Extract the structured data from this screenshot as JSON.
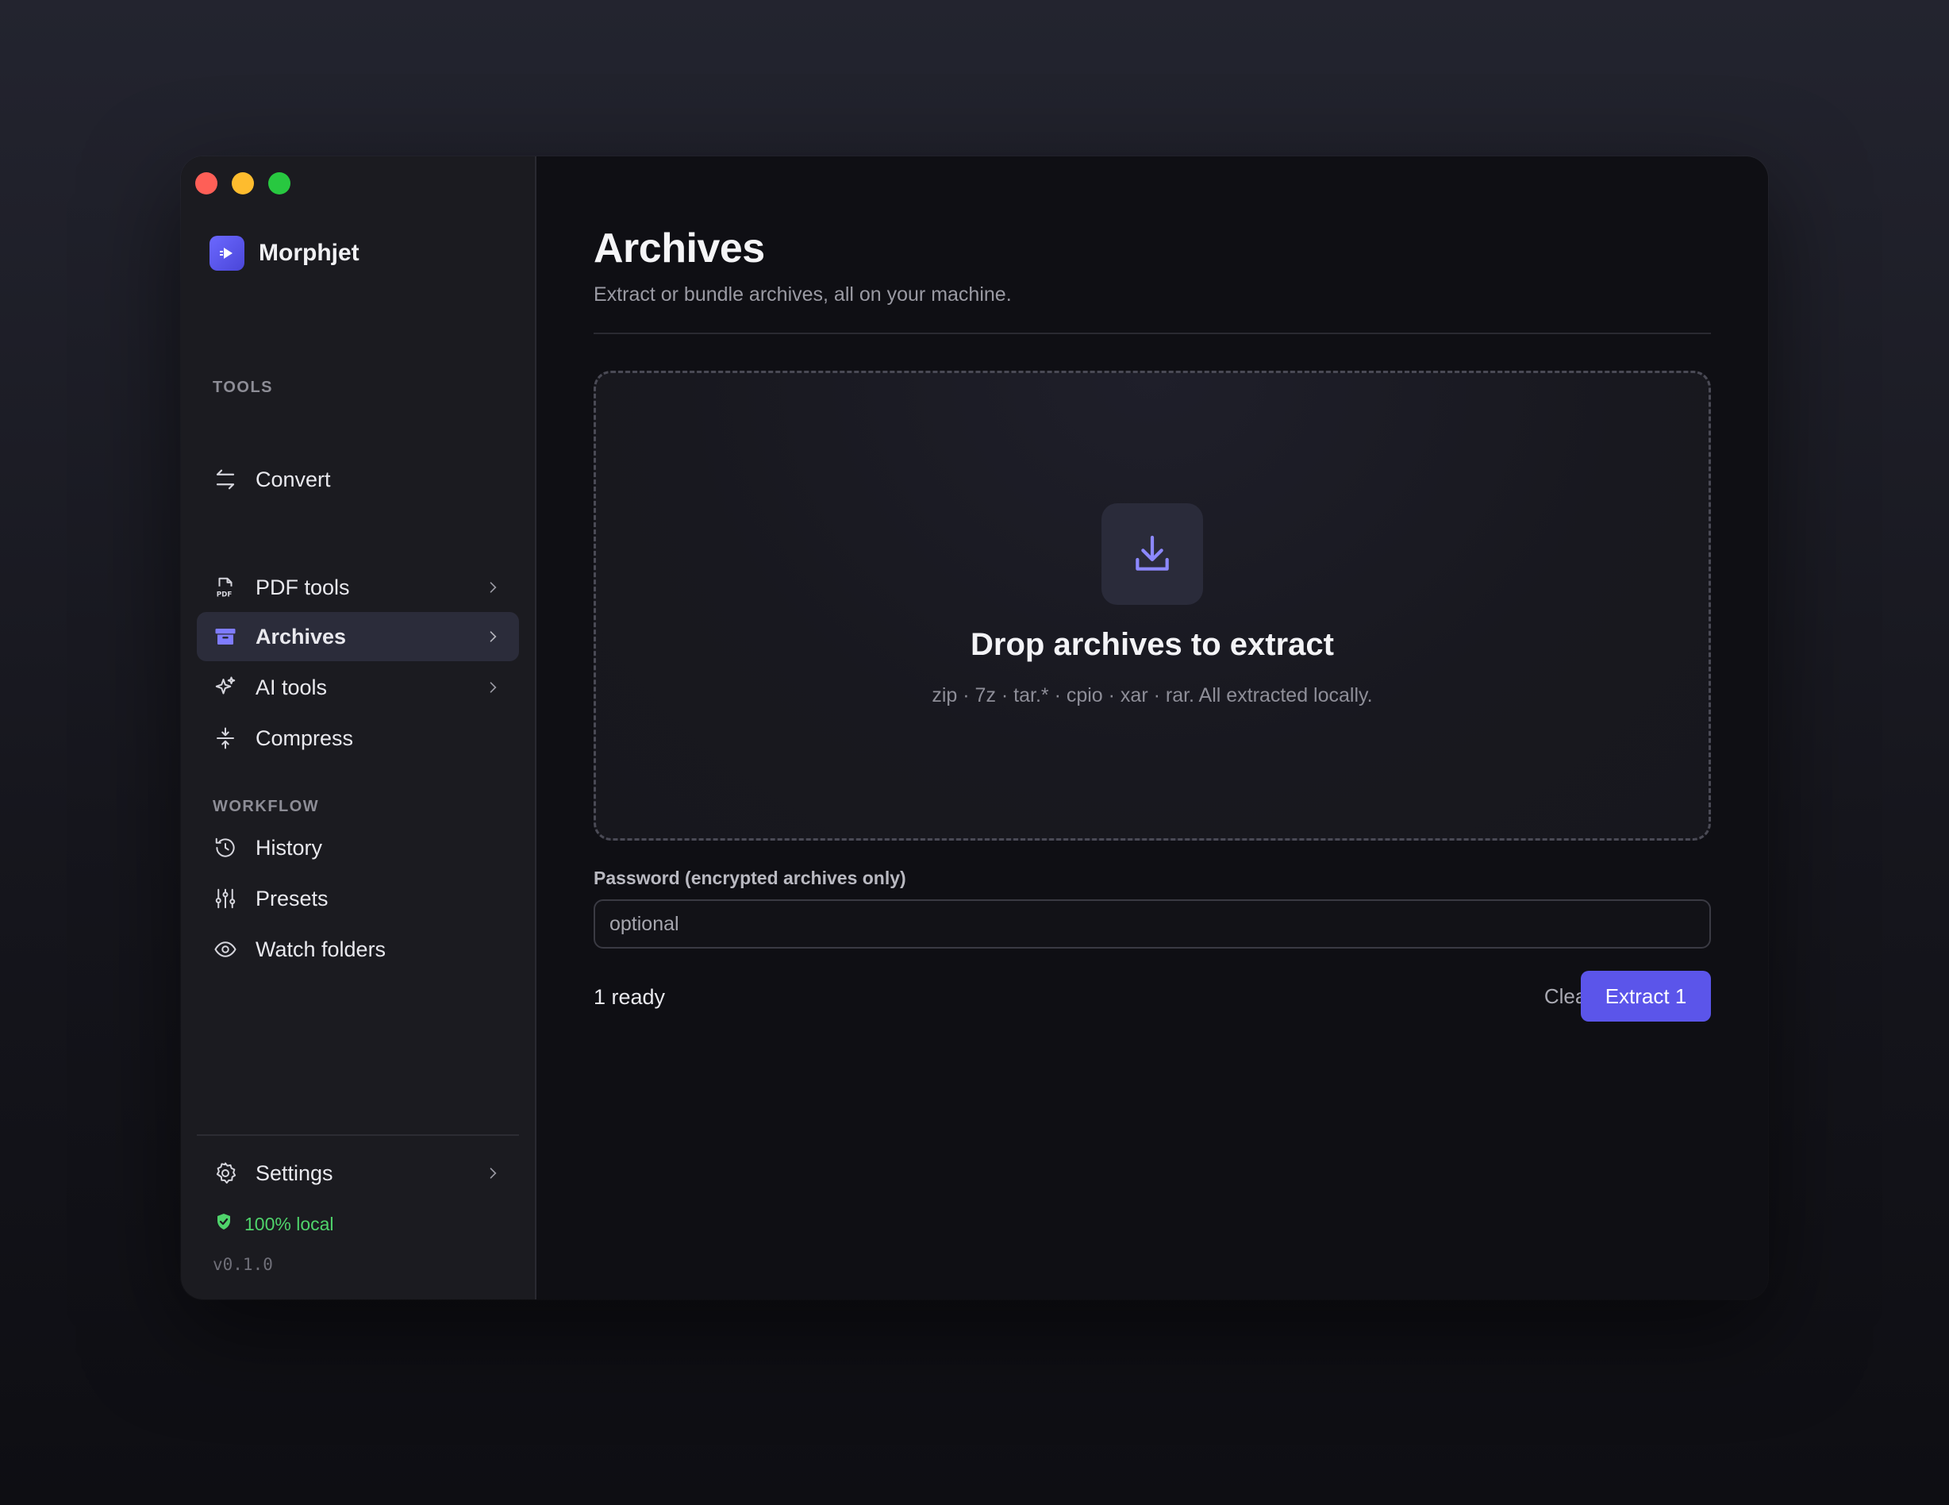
{
  "app": {
    "name": "Morphjet"
  },
  "sidebar": {
    "convert": {
      "label": "Convert",
      "icon": "arrows-exchange-icon"
    },
    "tools_header": "TOOLS",
    "tools": [
      {
        "label": "PDF tools",
        "icon": "pdf-file-icon",
        "has_submenu": true
      },
      {
        "label": "Archives",
        "icon": "archive-box-icon",
        "has_submenu": true,
        "active": true
      },
      {
        "label": "AI tools",
        "icon": "sparkles-icon",
        "has_submenu": true
      },
      {
        "label": "Compress",
        "icon": "compress-icon",
        "has_submenu": false
      }
    ],
    "workflow_header": "WORKFLOW",
    "workflow": [
      {
        "label": "History",
        "icon": "history-icon"
      },
      {
        "label": "Presets",
        "icon": "sliders-icon"
      },
      {
        "label": "Watch folders",
        "icon": "eye-icon"
      }
    ],
    "settings": {
      "label": "Settings",
      "icon": "gear-icon"
    },
    "local_badge": "100% local",
    "version": "v0.1.0"
  },
  "main": {
    "title": "Archives",
    "subtitle": "Extract or bundle archives, all on your machine.",
    "dropzone": {
      "title": "Drop archives to extract",
      "subtitle": "zip · 7z · tar.* · cpio · xar · rar. All extracted locally."
    },
    "password": {
      "label": "Password (encrypted archives only)",
      "placeholder": "optional",
      "value": ""
    },
    "status": "1 ready",
    "clear_label": "Clear",
    "extract_label": "Extract 1"
  },
  "colors": {
    "accent": "#5b55ea",
    "local_green": "#4fd36b",
    "sidebar_bg": "#1b1b20",
    "main_bg": "#0f0f14"
  }
}
